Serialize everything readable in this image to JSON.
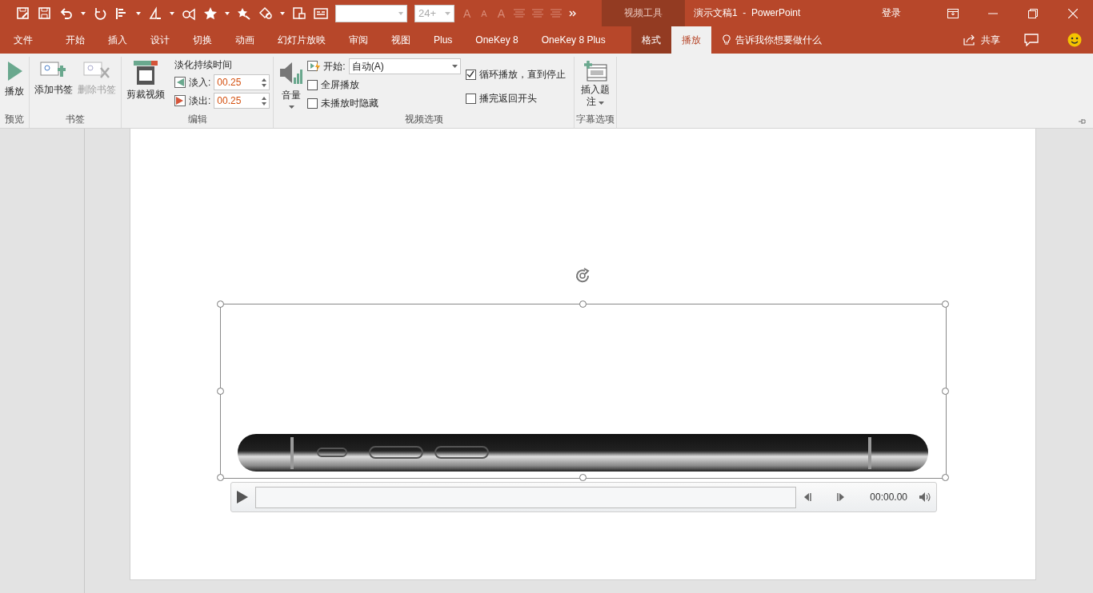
{
  "window": {
    "context_group": "视频工具",
    "title": "演示文稿1  -  PowerPoint",
    "sign_in": "登录"
  },
  "quick_access": {
    "font_size": "24+",
    "font_letters": [
      "A",
      "A",
      "A"
    ]
  },
  "tabs": [
    {
      "label": "文件",
      "selected": false,
      "contextual": false
    },
    {
      "label": "开始",
      "selected": false,
      "contextual": false
    },
    {
      "label": "插入",
      "selected": false,
      "contextual": false
    },
    {
      "label": "设计",
      "selected": false,
      "contextual": false
    },
    {
      "label": "切换",
      "selected": false,
      "contextual": false
    },
    {
      "label": "动画",
      "selected": false,
      "contextual": false
    },
    {
      "label": "幻灯片放映",
      "selected": false,
      "contextual": false
    },
    {
      "label": "审阅",
      "selected": false,
      "contextual": false
    },
    {
      "label": "视图",
      "selected": false,
      "contextual": false
    },
    {
      "label": "Plus",
      "selected": false,
      "contextual": false
    },
    {
      "label": "OneKey 8",
      "selected": false,
      "contextual": false
    },
    {
      "label": "OneKey 8 Plus",
      "selected": false,
      "contextual": false
    },
    {
      "label": "格式",
      "selected": false,
      "contextual": true
    },
    {
      "label": "播放",
      "selected": true,
      "contextual": true
    }
  ],
  "tell_me": {
    "placeholder": "告诉我你想要做什么"
  },
  "share": "共享",
  "ribbon": {
    "groups": [
      {
        "kind": "preview",
        "label": "预览",
        "buttons": [
          {
            "label": "播放",
            "disabled": false
          }
        ]
      },
      {
        "kind": "bookmarks",
        "label": "书签",
        "buttons": [
          {
            "label": "添加书签",
            "disabled": false
          },
          {
            "label": "删除书签",
            "disabled": true
          }
        ]
      },
      {
        "kind": "edit",
        "label": "编辑",
        "buttons": [
          {
            "label": "剪裁视频",
            "disabled": false
          }
        ],
        "fade_title": "淡化持续时间",
        "fades": [
          {
            "label": "淡入:",
            "value": "00.25"
          },
          {
            "label": "淡出:",
            "value": "00.25"
          }
        ]
      },
      {
        "kind": "options",
        "label": "视频选项",
        "volume": "音量",
        "start_label": "开始:",
        "start_value": "自动(A)",
        "checkboxes": [
          {
            "label": "全屏播放",
            "checked": false
          },
          {
            "label": "未播放时隐藏",
            "checked": false
          },
          {
            "label": "循环播放，直到停止",
            "checked": true
          },
          {
            "label": "播完返回开头",
            "checked": false
          }
        ]
      },
      {
        "kind": "captions",
        "label": "字幕选项",
        "buttons": [
          {
            "label": "插入题注",
            "disabled": false
          }
        ]
      }
    ]
  },
  "player": {
    "time": "00:00.00"
  }
}
